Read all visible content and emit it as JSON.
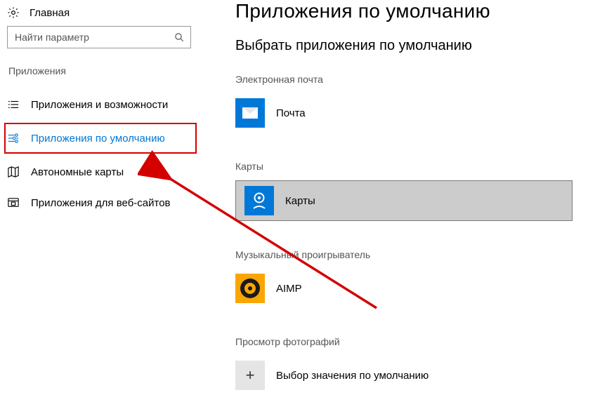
{
  "sidebar": {
    "home": "Главная",
    "search_placeholder": "Найти параметр",
    "section_heading": "Приложения",
    "items": [
      {
        "label": "Приложения и возможности"
      },
      {
        "label": "Приложения по умолчанию"
      },
      {
        "label": "Автономные карты"
      },
      {
        "label": "Приложения для веб-сайтов"
      }
    ]
  },
  "content": {
    "page_title": "Приложения по умолчанию",
    "choose_heading": "Выбрать приложения по умолчанию",
    "sections": {
      "email": {
        "heading": "Электронная почта",
        "app_label": "Почта"
      },
      "maps": {
        "heading": "Карты",
        "app_label": "Карты"
      },
      "music": {
        "heading": "Музыкальный проигрыватель",
        "app_label": "AIMP"
      },
      "photos": {
        "heading": "Просмотр фотографий",
        "app_label": "Выбор значения по умолчанию"
      }
    }
  }
}
